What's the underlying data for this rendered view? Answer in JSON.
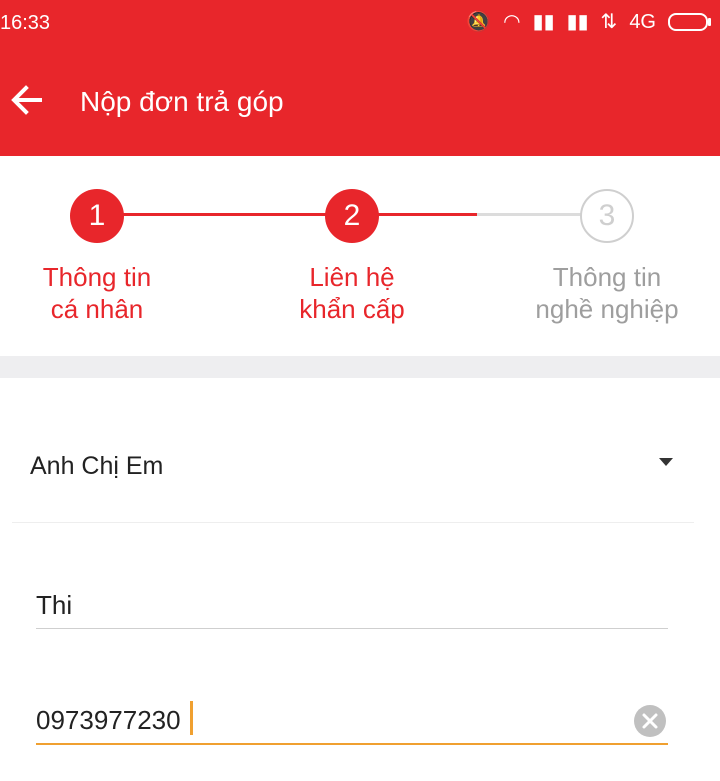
{
  "status_bar": {
    "time": "16:33",
    "network": "4G"
  },
  "app_bar": {
    "title": "Nộp đơn trả góp",
    "back_icon": "arrow-left-icon"
  },
  "stepper": {
    "steps": [
      {
        "number": "1",
        "line1": "Thông tin",
        "line2": "cá nhân",
        "state": "active"
      },
      {
        "number": "2",
        "line1": "Liên hệ",
        "line2": "khẩn cấp",
        "state": "active"
      },
      {
        "number": "3",
        "line1": "Thông tin",
        "line2": "nghề nghiệp",
        "state": "inactive"
      }
    ]
  },
  "form": {
    "relationship": {
      "value": "Anh Chị Em"
    },
    "contact_name": {
      "value": "Thi"
    },
    "contact_phone": {
      "value": "0973977230"
    }
  },
  "colors": {
    "primary": "#e8262b",
    "inactive": "#9e9e9e",
    "focus": "#f0a030"
  }
}
